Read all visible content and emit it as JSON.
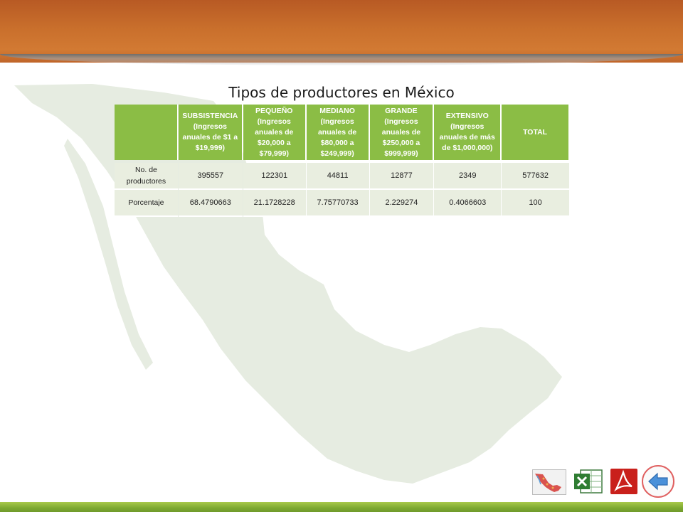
{
  "slide": {
    "title": "Tipos de productores en México"
  },
  "table": {
    "headers": [
      "",
      "SUBSISTENCIA (Ingresos anuales de $1 a $19,999)",
      "PEQUEÑO (Ingresos anuales de $20,000 a $79,999)",
      "MEDIANO (Ingresos anuales de $80,000 a $249,999)",
      "GRANDE (Ingresos anuales de $250,000 a $999,999)",
      "EXTENSIVO (Ingresos anuales de más de $1,000,000)",
      "TOTAL"
    ],
    "rows": [
      {
        "label": "No. de productores",
        "values": [
          "395557",
          "122301",
          "44811",
          "12877",
          "2349",
          "577632"
        ]
      },
      {
        "label": "Porcentaje",
        "values": [
          "68.4790663",
          "21.1728228",
          "7.75770733",
          "2.229274",
          "0.4066603",
          "100"
        ]
      }
    ]
  },
  "colors": {
    "header_band": "#c96f2c",
    "table_header": "#8bbd45",
    "table_cell": "#e9eee0",
    "footer_band": "#7da831"
  },
  "footer_icons": [
    "map-thumbnail-icon",
    "excel-icon",
    "pdf-icon",
    "back-arrow-icon"
  ]
}
